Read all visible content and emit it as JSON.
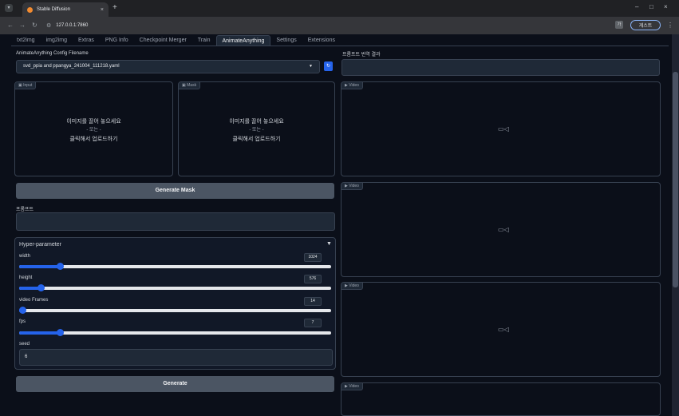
{
  "browser": {
    "tab_title": "Stable Diffusion",
    "tab_close": "×",
    "new_tab": "+",
    "url": "127.0.0.1:7860",
    "profile_label": "게스트",
    "window_minimize": "–",
    "window_maximize": "□",
    "window_close": "×"
  },
  "tabs": [
    {
      "label": "txt2img"
    },
    {
      "label": "img2img"
    },
    {
      "label": "Extras"
    },
    {
      "label": "PNG Info"
    },
    {
      "label": "Checkpoint Merger"
    },
    {
      "label": "Train"
    },
    {
      "label": "AnimateAnything",
      "active": true
    },
    {
      "label": "Settings"
    },
    {
      "label": "Extensions"
    }
  ],
  "config": {
    "label": "AnimateAnything Config Filename",
    "value": "svd_ppia and ppangya_241004_111218.yaml"
  },
  "translation": {
    "label": "프롬프트 번역 결과"
  },
  "input_panel": {
    "tag": "Input",
    "drop_line1": "이미지를 끌어 놓으세요",
    "drop_line2": "- 또는 -",
    "drop_line3": "클릭해서 업로드하기"
  },
  "mask_panel": {
    "tag": "Mask",
    "drop_line1": "이미지를 끌어 놓으세요",
    "drop_line2": "- 또는 -",
    "drop_line3": "클릭해서 업로드하기"
  },
  "video_tag": "Video",
  "generate_mask_label": "Generate Mask",
  "prompt_label": "프롬프트",
  "hyper": {
    "title": "Hyper-parameter",
    "toggle": "▼",
    "sliders": [
      {
        "label": "width",
        "value": "1024",
        "fraction": 0.13
      },
      {
        "label": "height",
        "value": "576",
        "fraction": 0.07
      },
      {
        "label": "video Frames",
        "value": "14",
        "fraction": 0.01
      },
      {
        "label": "fps",
        "value": "7",
        "fraction": 0.13
      }
    ],
    "seed_label": "seed",
    "seed_value": "6"
  },
  "generate_label": "Generate"
}
